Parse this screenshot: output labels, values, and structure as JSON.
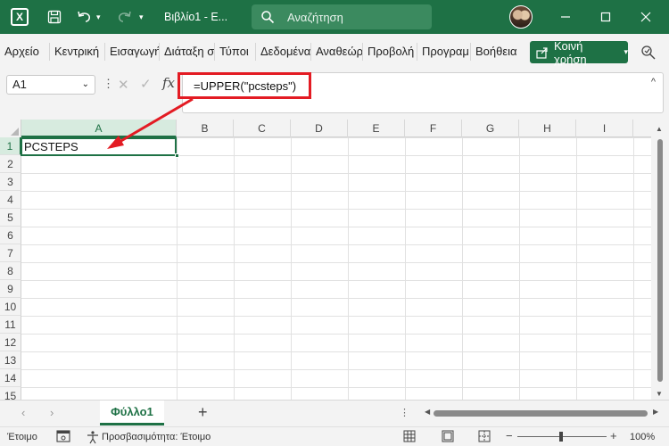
{
  "titlebar": {
    "app_icon_letter": "X",
    "title": "Βιβλίο1 - Ε...",
    "search_placeholder": "Αναζήτηση"
  },
  "ribbon": {
    "tabs": [
      "Αρχείο",
      "Κεντρική",
      "Εισαγωγή",
      "Διάταξη σ",
      "Τύποι",
      "Δεδομένα",
      "Αναθεώρ",
      "Προβολή",
      "Προγραμ",
      "Βοήθεια"
    ],
    "share_label": "Κοινή χρήση"
  },
  "formula_bar": {
    "name_box": "A1",
    "fx_label": "fx",
    "formula": "=UPPER(\"pcsteps\")"
  },
  "grid": {
    "columns": [
      "A",
      "B",
      "C",
      "D",
      "E",
      "F",
      "G",
      "H",
      "I"
    ],
    "rows": [
      "1",
      "2",
      "3",
      "4",
      "5",
      "6",
      "7",
      "8",
      "9",
      "10",
      "11",
      "12",
      "13",
      "14",
      "15"
    ],
    "active_cell": "A1",
    "cell_a1_value": "PCSTEPS"
  },
  "sheets": {
    "active": "Φύλλο1",
    "add_label": "+"
  },
  "status": {
    "ready": "Έτοιμο",
    "accessibility": "Προσβασιμότητα: Έτοιμο",
    "zoom": "100%"
  },
  "colors": {
    "brand": "#1e7145",
    "annotation": "#e31b23"
  }
}
